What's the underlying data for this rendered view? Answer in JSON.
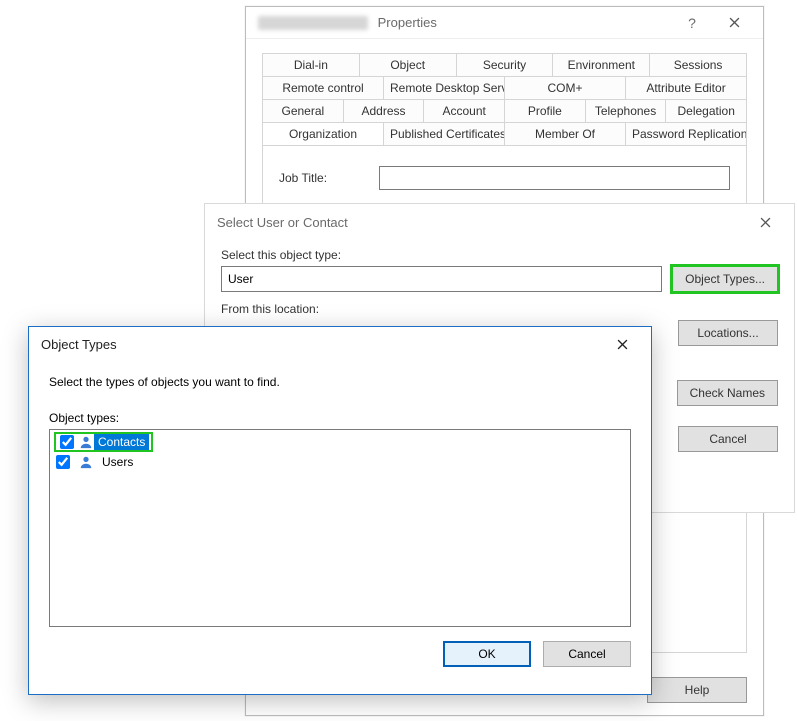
{
  "properties_window": {
    "title_suffix": "Properties",
    "help_glyph": "?",
    "tab_rows": [
      [
        "Dial-in",
        "Object",
        "Security",
        "Environment",
        "Sessions"
      ],
      [
        "Remote control",
        "Remote Desktop Services Profile",
        "COM+",
        "Attribute Editor"
      ],
      [
        "General",
        "Address",
        "Account",
        "Profile",
        "Telephones",
        "Delegation"
      ],
      [
        "Organization",
        "Published Certificates",
        "Member Of",
        "Password Replication"
      ]
    ],
    "active_tab": "Organization",
    "fields": {
      "job_title_label": "Job Title:",
      "job_title_value": ""
    },
    "buttons": {
      "help": "Help"
    }
  },
  "select_dialog": {
    "title": "Select User or Contact",
    "object_type_label": "Select this object type:",
    "object_type_value": "User",
    "object_types_btn": "Object Types...",
    "from_location_label": "From this location:",
    "locations_btn": "Locations...",
    "check_names_btn": "Check Names",
    "cancel_btn": "Cancel"
  },
  "object_types_dialog": {
    "title": "Object Types",
    "prompt": "Select the types of objects you want to find.",
    "list_label": "Object types:",
    "items": [
      {
        "label": "Contacts",
        "checked": true,
        "selected": true,
        "highlighted": true
      },
      {
        "label": "Users",
        "checked": true,
        "selected": false,
        "highlighted": false
      }
    ],
    "ok_btn": "OK",
    "cancel_btn": "Cancel"
  }
}
